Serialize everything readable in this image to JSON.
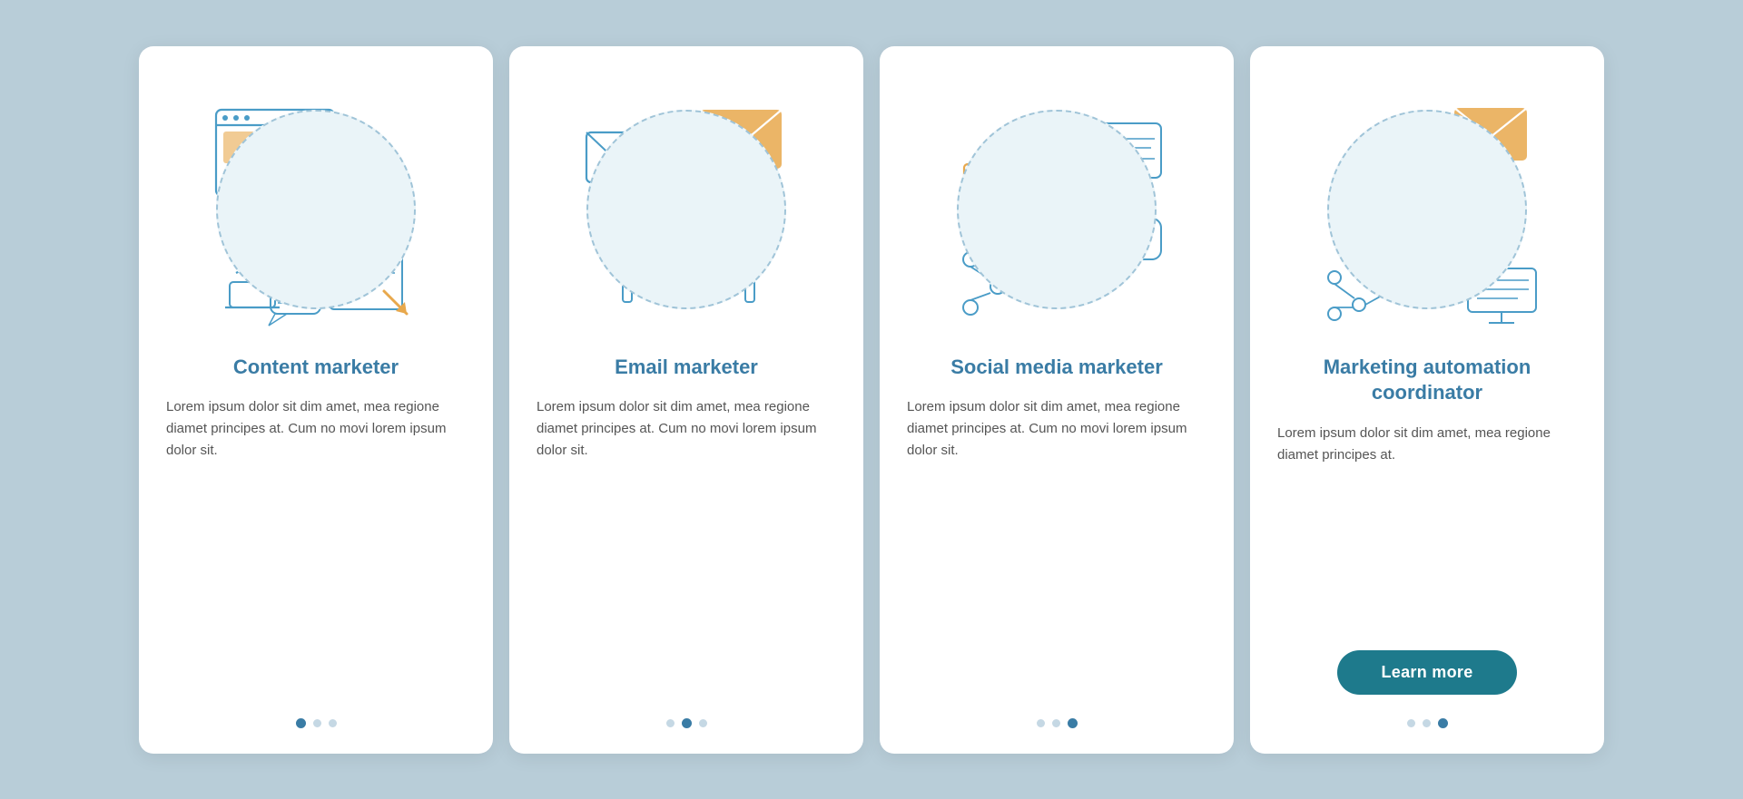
{
  "cards": [
    {
      "id": "content-marketer",
      "title": "Content marketer",
      "body": "Lorem ipsum dolor sit dim amet, mea regione diamet principes at. Cum no movi lorem ipsum dolor sit.",
      "dots": [
        true,
        false,
        false
      ],
      "hasButton": false,
      "buttonLabel": ""
    },
    {
      "id": "email-marketer",
      "title": "Email marketer",
      "body": "Lorem ipsum dolor sit dim amet, mea regione diamet principes at. Cum no movi lorem ipsum dolor sit.",
      "dots": [
        false,
        true,
        false
      ],
      "hasButton": false,
      "buttonLabel": ""
    },
    {
      "id": "social-media-marketer",
      "title": "Social media marketer",
      "body": "Lorem ipsum dolor sit dim amet, mea regione diamet principes at. Cum no movi lorem ipsum dolor sit.",
      "dots": [
        false,
        false,
        true
      ],
      "hasButton": false,
      "buttonLabel": ""
    },
    {
      "id": "marketing-automation-coordinator",
      "title": "Marketing automation coordinator",
      "body": "Lorem ipsum dolor sit dim amet, mea regione diamet principes at.",
      "dots": [
        false,
        false,
        true
      ],
      "hasButton": true,
      "buttonLabel": "Learn more"
    }
  ]
}
